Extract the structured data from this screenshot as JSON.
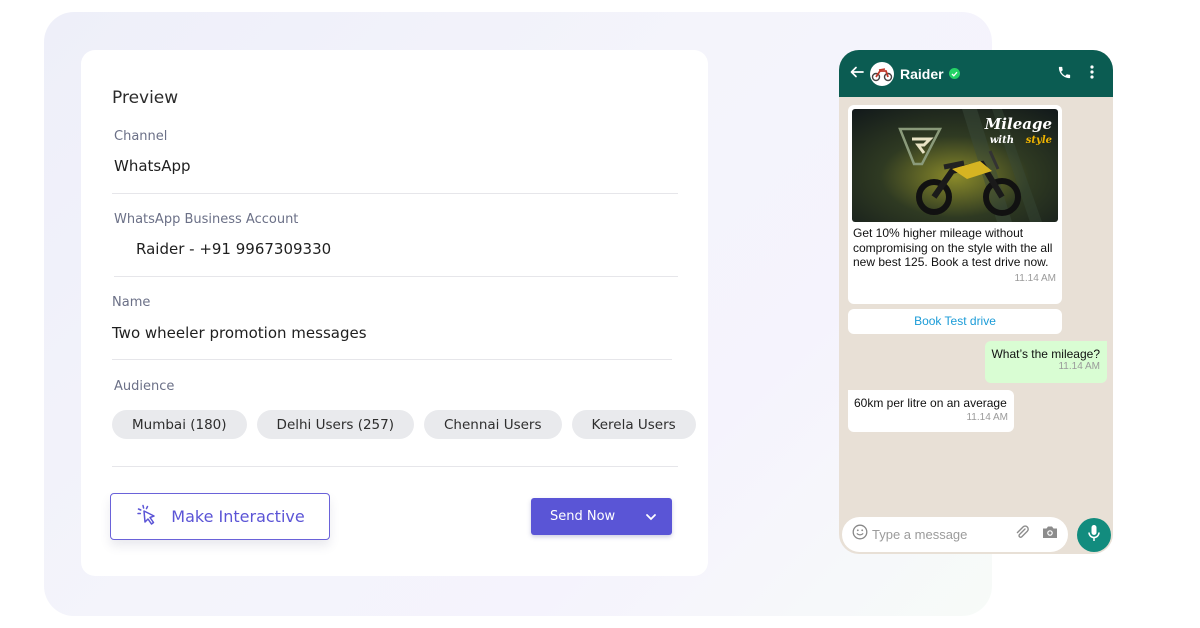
{
  "preview": {
    "title": "Preview",
    "channel": {
      "label": "Channel",
      "value": "WhatsApp"
    },
    "business_account": {
      "label": "WhatsApp Business Account",
      "value": "Raider - +91 9967309330"
    },
    "name": {
      "label": "Name",
      "value": "Two wheeler promotion messages"
    },
    "audience": {
      "label": "Audience",
      "chips": [
        "Mumbai (180)",
        "Delhi Users (257)",
        "Chennai Users",
        "Kerela Users"
      ]
    },
    "make_interactive_label": "Make Interactive",
    "send_now_label": "Send Now",
    "colors": {
      "accent": "#5a55d6"
    }
  },
  "whatsapp": {
    "contact_name": "Raider",
    "verified": true,
    "promo_image": {
      "headline": "Mileage",
      "subline_prefix": "with",
      "subline_accent": "style"
    },
    "promo_text": "Get 10% higher mileage without compromising on the style with the all new best 125. Book a test drive now.",
    "promo_time": "11.14 AM",
    "cta_label": "Book Test drive",
    "outgoing_text": "What’s the mileage?",
    "outgoing_time": "11.14 AM",
    "reply_text": "60km per litre on an average",
    "reply_time": "11.14 AM",
    "input_placeholder": "Type a message",
    "colors": {
      "header": "#0b5c52",
      "chat_bg": "#e8e0d6",
      "outgoing": "#d9fdd3",
      "mic": "#128c7e",
      "link": "#1a9bd7"
    }
  }
}
